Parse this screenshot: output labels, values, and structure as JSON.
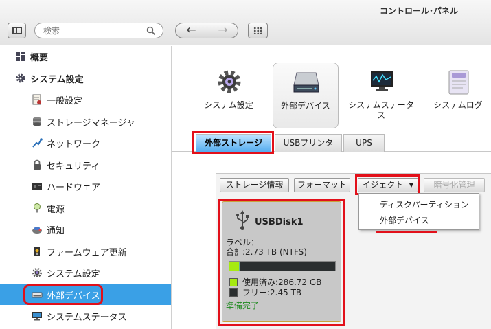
{
  "app": {
    "title": "コントロール･パネル"
  },
  "search": {
    "placeholder": "検索"
  },
  "sidebar": {
    "items": [
      {
        "label": "概要",
        "icon": "overview-icon"
      },
      {
        "label": "システム設定",
        "icon": "gear-icon"
      },
      {
        "label": "一般設定",
        "icon": "general-settings-icon"
      },
      {
        "label": "ストレージマネージャ",
        "icon": "storage-manager-icon"
      },
      {
        "label": "ネットワーク",
        "icon": "network-icon"
      },
      {
        "label": "セキュリティ",
        "icon": "lock-icon"
      },
      {
        "label": "ハードウェア",
        "icon": "hardware-icon"
      },
      {
        "label": "電源",
        "icon": "power-bulb-icon"
      },
      {
        "label": "通知",
        "icon": "notification-icon"
      },
      {
        "label": "ファームウェア更新",
        "icon": "firmware-update-icon"
      },
      {
        "label": "システム設定",
        "icon": "system-settings-icon"
      },
      {
        "label": "外部デバイス",
        "icon": "external-drive-icon"
      },
      {
        "label": "システムステータス",
        "icon": "monitor-icon"
      }
    ]
  },
  "main": {
    "apps": [
      {
        "label": "システム設定",
        "icon": "gear-app-icon"
      },
      {
        "label": "外部デバイス",
        "icon": "hard-drive-app-icon"
      },
      {
        "label": "システムステータス",
        "icon": "monitor-app-icon"
      },
      {
        "label": "システムログ",
        "icon": "log-app-icon"
      }
    ],
    "tabs": [
      {
        "label": "外部ストレージ"
      },
      {
        "label": "USBプリンタ"
      },
      {
        "label": "UPS"
      }
    ],
    "toolbar": {
      "storage_info": "ストレージ情報",
      "format": "フォーマット",
      "eject": "イジェクト",
      "encryption": "暗号化管理"
    },
    "eject_menu": {
      "items": [
        "ディスクパーティション",
        "外部デバイス"
      ]
    },
    "disk": {
      "name": "USBDisk1",
      "label_line": "ラベル：",
      "total_line": "合計:2.73 TB (NTFS)",
      "used_line": "使用済み:286.72 GB",
      "free_line": "フリー:2.45 TB",
      "status": "準備完了",
      "used_fraction": 0.1,
      "colors": {
        "used": "#a6ea12",
        "free": "#2b2f30",
        "status": "#1f8a1f"
      }
    }
  },
  "colors": {
    "highlight": "#e2101a",
    "selected": "#3aa0e6"
  }
}
